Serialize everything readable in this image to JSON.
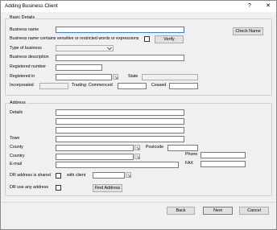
{
  "window": {
    "title": "Adding Business Client",
    "help_label": "?",
    "close_label": "✕"
  },
  "basic": {
    "legend": "Basic Details",
    "business_name_label": "Business name",
    "business_name_value": "",
    "check_name_label": "Check Name",
    "sensitive_label": "Business name contains sensitive or restricted words or expressions",
    "sensitive_checked": false,
    "verify_label": "Verify",
    "type_label": "Type of business",
    "type_value": "",
    "description_label": "Business description",
    "description_value": "",
    "registered_number_label": "Registered number",
    "registered_number_value": "",
    "registered_in_label": "Registered in",
    "registered_in_value": "",
    "state_label": "State",
    "state_value": "",
    "incorporated_label": "Incorporated",
    "incorporated_value": "",
    "trading_label": "Trading: Commenced",
    "trading_value": "",
    "ceased_label": "Ceased",
    "ceased_value": ""
  },
  "address": {
    "legend": "Address",
    "details_label": "Details",
    "line1": "",
    "line2": "",
    "line3": "",
    "line4": "",
    "town_label": "Town",
    "town_value": "",
    "county_label": "County",
    "county_value": "",
    "postcode_label": "Postcode",
    "postcode_value": "",
    "country_label": "Country",
    "country_value": "",
    "phone_label": "Phone",
    "phone_value": "",
    "email_label": "E-mail",
    "email_value": "",
    "fax_label": "FAX",
    "fax_value": "",
    "dr_shared_label": "DR address is shared",
    "dr_shared_checked": false,
    "with_client_label": "with client",
    "with_client_value": "",
    "dr_any_label": "DR use any address",
    "dr_any_checked": false,
    "find_address_label": "Find Address"
  },
  "footer": {
    "back_label": "Back",
    "next_label": "Next",
    "cancel_label": "Cancel"
  },
  "icons": {
    "lookup": "lookup-icon",
    "dropdown": "chevron-down-icon"
  },
  "colors": {
    "focus_border": "#3c7fd1",
    "window_bg": "#f0f0f0"
  }
}
